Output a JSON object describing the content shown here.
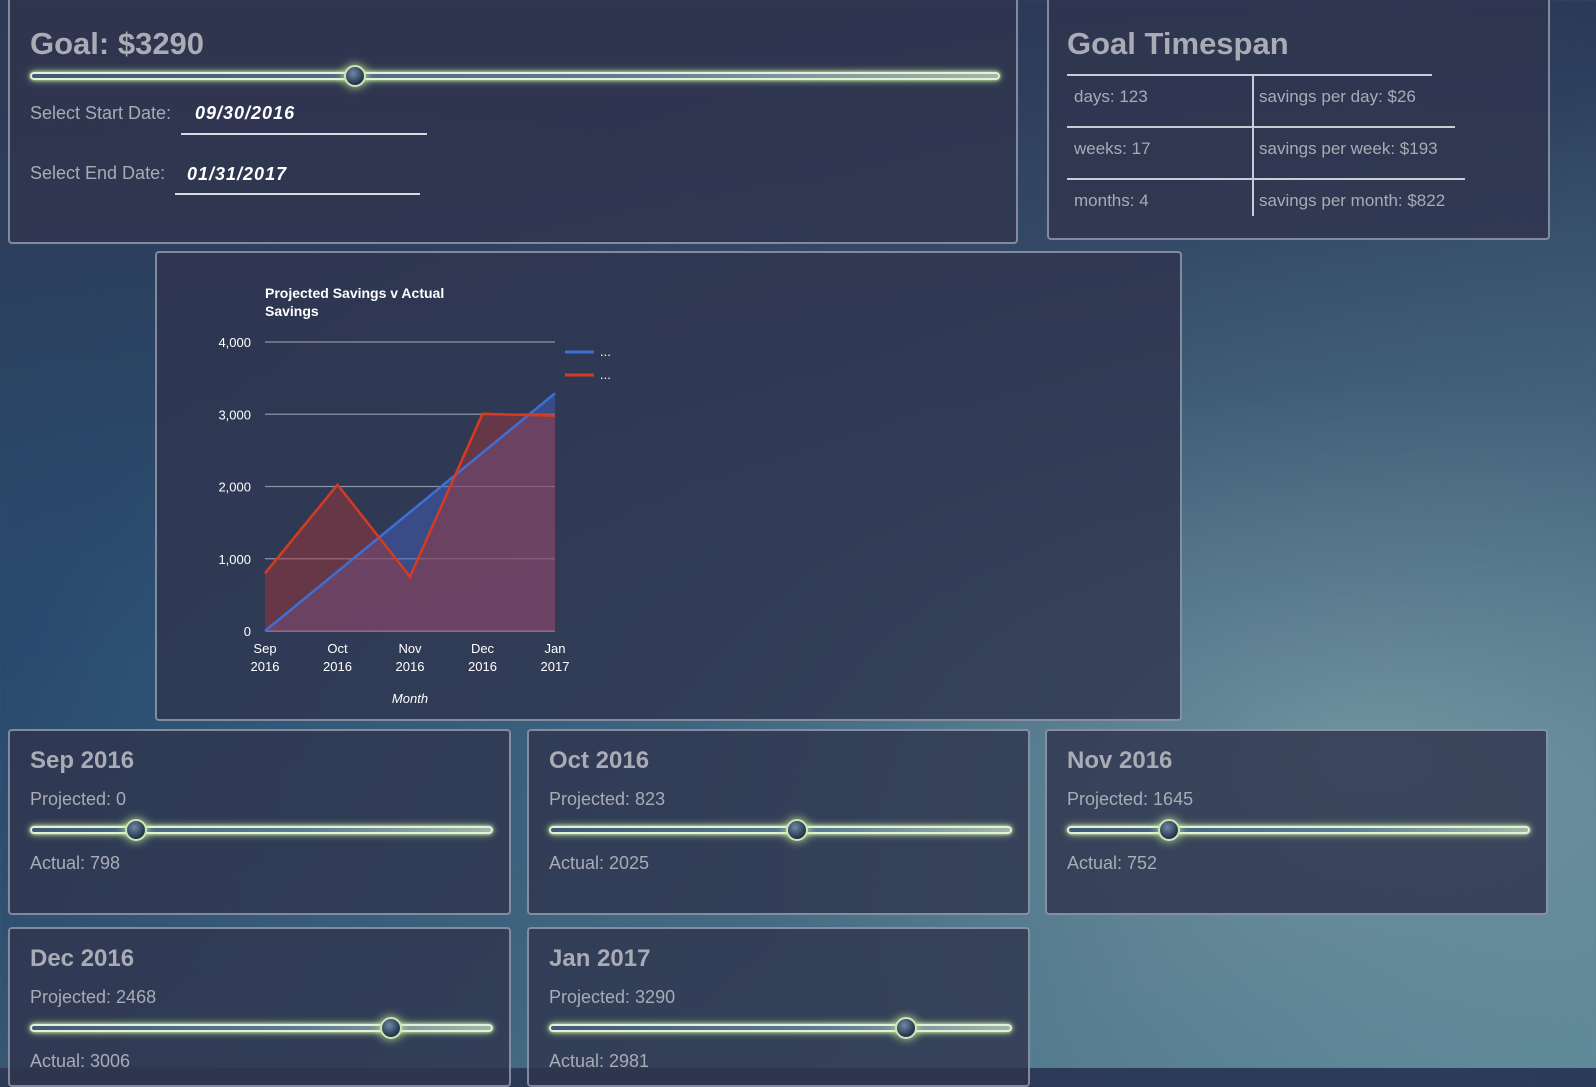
{
  "goal": {
    "title": "Goal: $3290",
    "slider_fraction": 0.335,
    "start_label": "Select Start Date:",
    "start_value": "09/30/2016",
    "end_label": "Select End Date:",
    "end_value": "01/31/2017"
  },
  "timespan": {
    "title": "Goal Timespan",
    "rows": [
      {
        "left": "days: 123",
        "right": "savings per day: $26"
      },
      {
        "left": "weeks: 17",
        "right": "savings per week: $193"
      },
      {
        "left": "months: 4",
        "right": "savings per month: $822"
      }
    ]
  },
  "chart_data": {
    "type": "area",
    "title_lines": [
      "Projected Savings v Actual",
      "Savings"
    ],
    "xlabel": "Month",
    "ylabel": "",
    "categories": [
      [
        "Sep",
        "2016"
      ],
      [
        "Oct",
        "2016"
      ],
      [
        "Nov",
        "2016"
      ],
      [
        "Dec",
        "2016"
      ],
      [
        "Jan",
        "2017"
      ]
    ],
    "ylim": [
      0,
      4000
    ],
    "yticks": [
      "0",
      "1,000",
      "2,000",
      "3,000",
      "4,000"
    ],
    "ytick_values": [
      0,
      1000,
      2000,
      3000,
      4000
    ],
    "series": [
      {
        "legend": "...",
        "color": "#3d6fd6",
        "fill": "rgba(70,100,200,0.45)",
        "values": [
          0,
          823,
          1645,
          2468,
          3290
        ]
      },
      {
        "legend": "...",
        "color": "#d53b20",
        "fill": "rgba(170,55,55,0.45)",
        "values": [
          798,
          2025,
          752,
          3006,
          2981
        ]
      }
    ],
    "grid": true,
    "legend_position": "right"
  },
  "months": [
    {
      "title": "Sep 2016",
      "projected": "Projected: 0",
      "actual": "Actual: 798",
      "slider_fraction": 0.23
    },
    {
      "title": "Oct 2016",
      "projected": "Projected: 823",
      "actual": "Actual: 2025",
      "slider_fraction": 0.535
    },
    {
      "title": "Nov 2016",
      "projected": "Projected: 1645",
      "actual": "Actual: 752",
      "slider_fraction": 0.22
    },
    {
      "title": "Dec 2016",
      "projected": "Projected: 2468",
      "actual": "Actual: 3006",
      "slider_fraction": 0.78
    },
    {
      "title": "Jan 2017",
      "projected": "Projected: 3290",
      "actual": "Actual: 2981",
      "slider_fraction": 0.77
    }
  ]
}
